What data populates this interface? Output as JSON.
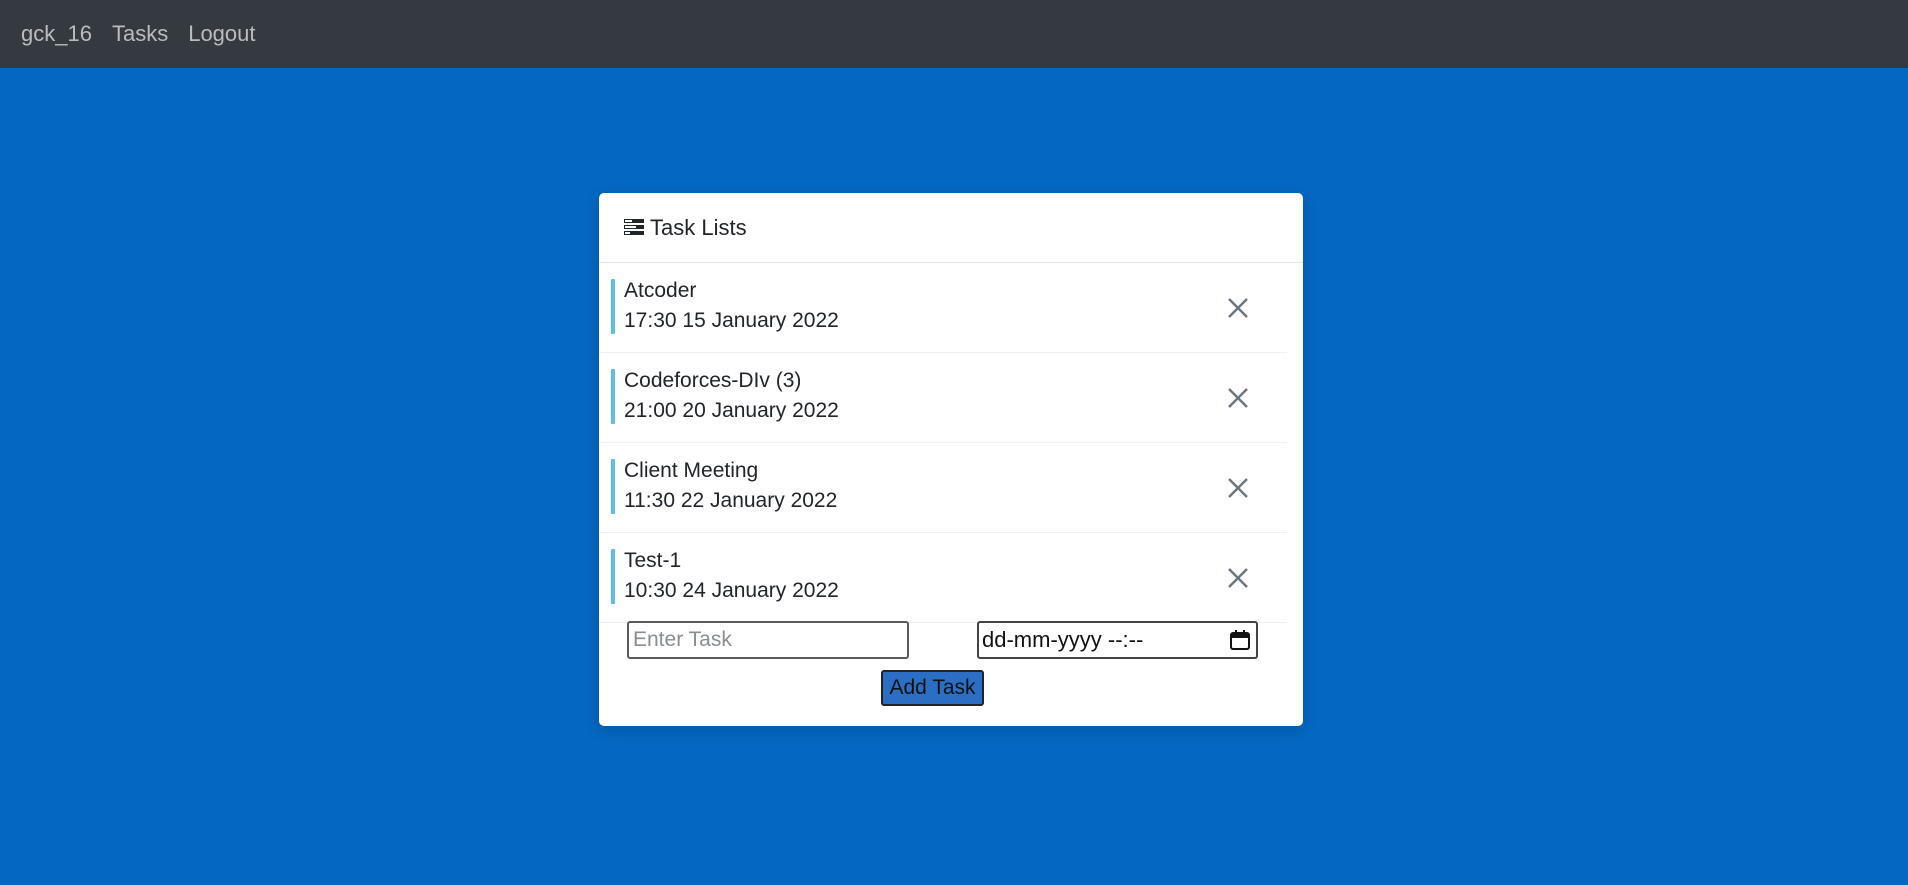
{
  "nav": {
    "brand": "gck_16",
    "tasks": "Tasks",
    "logout": "Logout"
  },
  "card": {
    "title": "Task Lists",
    "icon": "list-icon"
  },
  "tasks": [
    {
      "name": "Atcoder",
      "datetime": "17:30 15 January 2022"
    },
    {
      "name": "Codeforces-DIv (3)",
      "datetime": "21:00 20 January 2022"
    },
    {
      "name": "Client Meeting",
      "datetime": "11:30 22 January 2022"
    },
    {
      "name": "Test-1",
      "datetime": "10:30 24 January 2022"
    }
  ],
  "form": {
    "task_placeholder": "Enter Task",
    "task_value": "",
    "date_placeholder": "dd-mm-yyyy --:--",
    "add_label": "Add Task"
  },
  "colors": {
    "background": "#0468c2",
    "navbar": "#343a40",
    "accent_bar": "#5bc0de",
    "button": "#2b6fc5"
  }
}
